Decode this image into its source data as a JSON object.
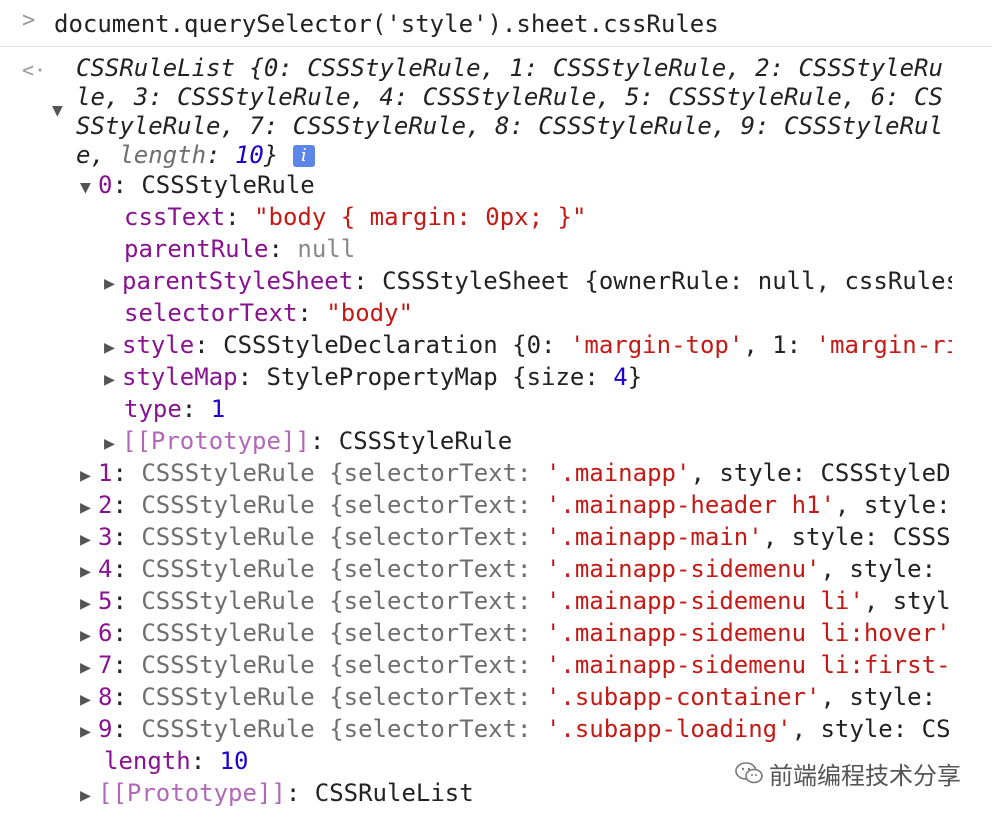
{
  "command": "document.querySelector('style').sheet.cssRules",
  "summary": {
    "line1": "CSSRuleList {0: CSSStyleRule, 1: CSSStyleRule, 2: CSSStyleRu",
    "line2": "le, 3: CSSStyleRule, 4: CSSStyleRule, 5: CSSStyleRule, 6: CS",
    "line3": "SStyleRule, 7: CSSStyleRule, 8: CSSStyleRule, 9: CSSStyleRul",
    "line4_prefix": "e, ",
    "length_key": "length",
    "length_value": "10",
    "close": "}",
    "info_badge": "i"
  },
  "rule0": {
    "index": "0",
    "type_name": "CSSStyleRule",
    "props": {
      "cssText_key": "cssText",
      "cssText_val": "\"body { margin: 0px; }\"",
      "parentRule_key": "parentRule",
      "parentRule_val": "null",
      "parentStyleSheet_key": "parentStyleSheet",
      "parentStyleSheet_val": "CSSStyleSheet {ownerRule: null, cssRules",
      "selectorText_key": "selectorText",
      "selectorText_val": "\"body\"",
      "style_key": "style",
      "style_val_pre": "CSSStyleDeclaration {0: ",
      "style_val_s0": "'margin-top'",
      "style_val_mid": ", 1: ",
      "style_val_s1": "'margin-ri",
      "styleMap_key": "styleMap",
      "styleMap_val_pre": "StylePropertyMap {size: ",
      "styleMap_size": "4",
      "styleMap_val_post": "}",
      "type_key": "type",
      "type_val": "1",
      "proto_key": "[[Prototype]]",
      "proto_val": "CSSStyleRule"
    }
  },
  "rules": [
    {
      "index": "1",
      "pre": "CSSStyleRule {selectorText: ",
      "sel": "'.mainapp'",
      "post": ", style: CSSStyleD"
    },
    {
      "index": "2",
      "pre": "CSSStyleRule {selectorText: ",
      "sel": "'.mainapp-header h1'",
      "post": ", style:"
    },
    {
      "index": "3",
      "pre": "CSSStyleRule {selectorText: ",
      "sel": "'.mainapp-main'",
      "post": ", style: CSSS"
    },
    {
      "index": "4",
      "pre": "CSSStyleRule {selectorText: ",
      "sel": "'.mainapp-sidemenu'",
      "post": ", style:"
    },
    {
      "index": "5",
      "pre": "CSSStyleRule {selectorText: ",
      "sel": "'.mainapp-sidemenu li'",
      "post": ", styl"
    },
    {
      "index": "6",
      "pre": "CSSStyleRule {selectorText: ",
      "sel": "'.mainapp-sidemenu li:hover'",
      "post": ""
    },
    {
      "index": "7",
      "pre": "CSSStyleRule {selectorText: ",
      "sel": "'.mainapp-sidemenu li:first-",
      "post": ""
    },
    {
      "index": "8",
      "pre": "CSSStyleRule {selectorText: ",
      "sel": "'.subapp-container'",
      "post": ", style:"
    },
    {
      "index": "9",
      "pre": "CSSStyleRule {selectorText: ",
      "sel": "'.subapp-loading'",
      "post": ", style: CS"
    }
  ],
  "footer": {
    "length_key": "length",
    "length_value": "10",
    "proto_key": "[[Prototype]]",
    "proto_val": "CSSRuleList"
  },
  "watermark": "前端编程技术分享",
  "icons": {
    "prompt": "chevron-right-icon",
    "result": "return-arrow-icon",
    "expand": "triangle-right-icon",
    "collapse": "triangle-down-icon",
    "info": "info-icon",
    "wechat": "wechat-icon"
  },
  "colors": {
    "key": "#881391",
    "string": "#c41a16",
    "number": "#1c00cf",
    "gray": "#6e6e6e",
    "info": "#5c87e8"
  }
}
